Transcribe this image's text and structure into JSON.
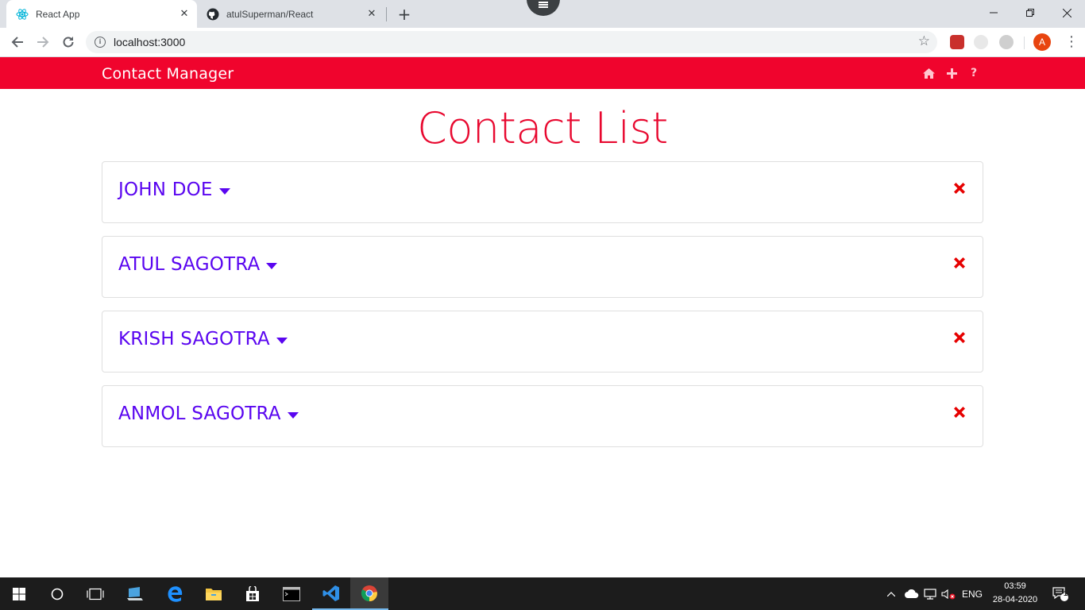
{
  "browser": {
    "tabs": [
      {
        "title": "React App",
        "icon": "react-icon",
        "active": true
      },
      {
        "title": "atulSuperman/React",
        "icon": "github-icon",
        "active": false
      }
    ],
    "url": "localhost:3000",
    "profile_initial": "A"
  },
  "app": {
    "brand": "Contact Manager",
    "nav_icons": [
      "home-icon",
      "plus-icon",
      "question-icon"
    ],
    "heading": "Contact List",
    "contacts": [
      {
        "name": "JOHN DOE"
      },
      {
        "name": "ATUL SAGOTRA"
      },
      {
        "name": "KRISH SAGOTRA"
      },
      {
        "name": "ANMOL SAGOTRA"
      }
    ]
  },
  "taskbar": {
    "language": "ENG",
    "time": "03:59",
    "date": "28-04-2020",
    "notification_count": "1"
  },
  "colors": {
    "navbar": "#f0042d",
    "heading": "#e8082f",
    "contact_name": "#5a06f0",
    "delete": "#e60000"
  }
}
